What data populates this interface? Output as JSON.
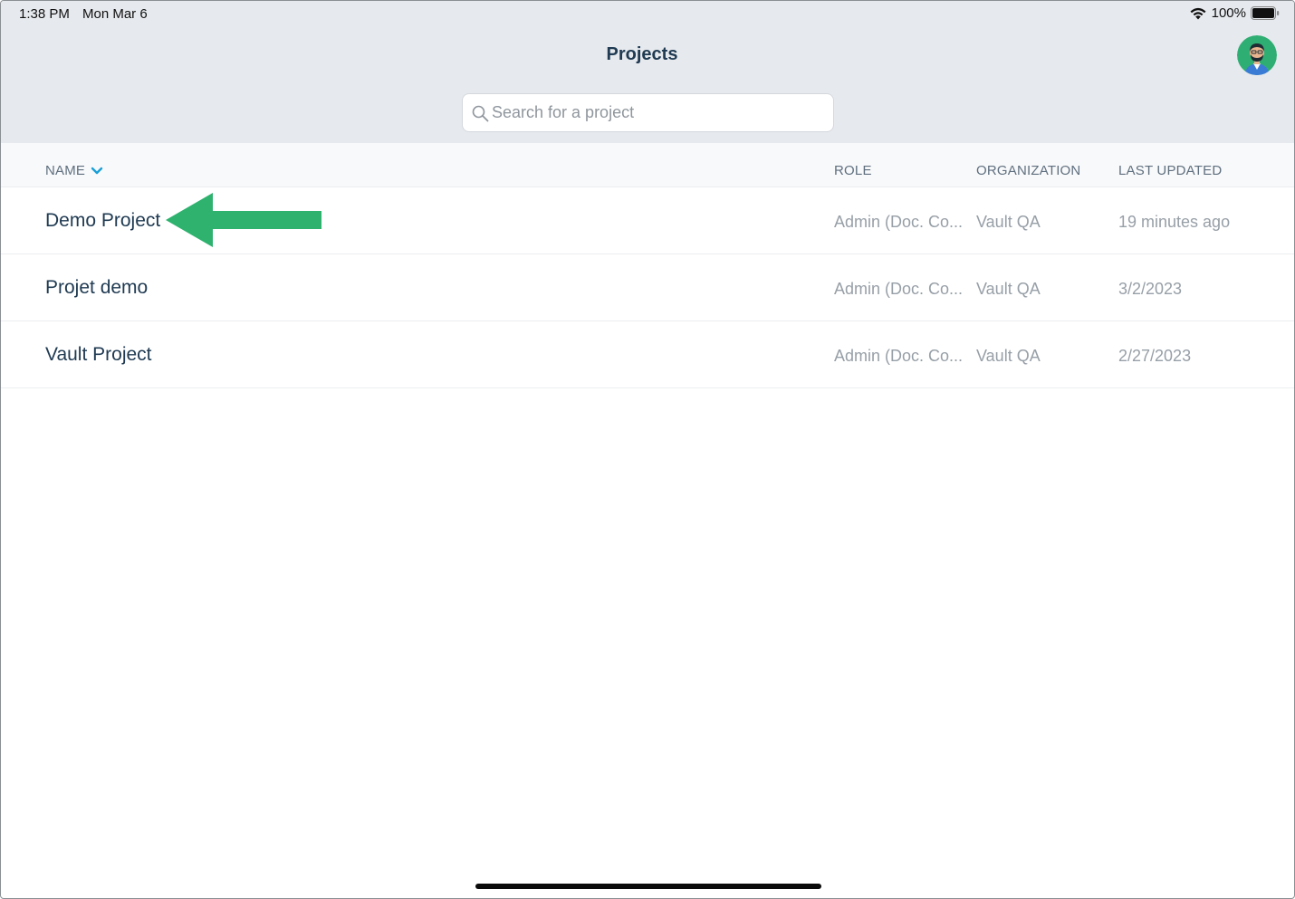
{
  "status_bar": {
    "time": "1:38 PM",
    "date": "Mon Mar 6",
    "battery": "100%",
    "icons": [
      "wifi-icon",
      "battery-icon"
    ]
  },
  "header": {
    "title": "Projects",
    "avatar": "avatar"
  },
  "search": {
    "placeholder": "Search for a project",
    "value": ""
  },
  "table": {
    "columns": {
      "name": "NAME",
      "role": "ROLE",
      "organization": "ORGANIZATION",
      "last_updated": "LAST UPDATED"
    },
    "sort_icon": "chevron-down-icon",
    "rows": [
      {
        "name": "Demo Project",
        "role": "Admin (Doc. Co...",
        "organization": "Vault QA",
        "last_updated": "19 minutes ago"
      },
      {
        "name": "Projet demo",
        "role": "Admin (Doc. Co...",
        "organization": "Vault QA",
        "last_updated": "3/2/2023"
      },
      {
        "name": "Vault Project",
        "role": "Admin (Doc. Co...",
        "organization": "Vault QA",
        "last_updated": "2/27/2023"
      }
    ]
  },
  "annotation": {
    "arrow_icon": "arrow-left-icon",
    "arrow_color": "#2eb26e"
  },
  "colors": {
    "header_bg": "#e6e9ed",
    "accent": "#1a9fd6",
    "title": "#1f3a52"
  }
}
